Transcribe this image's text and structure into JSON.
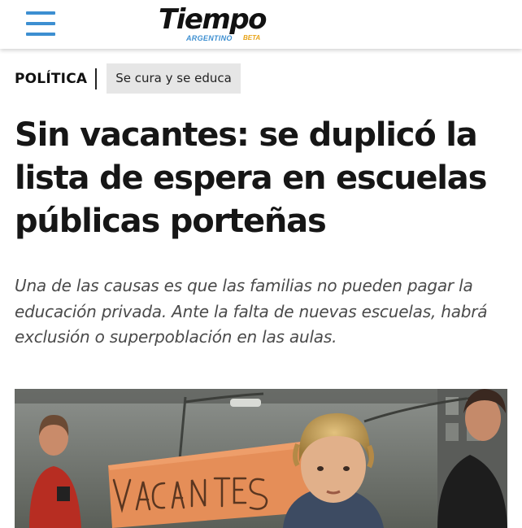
{
  "header": {
    "menu_icon": "hamburger-menu-icon",
    "logo": {
      "name": "Tiempo",
      "subtitle": "ARGENTINO",
      "badge": "BETA"
    },
    "colors": {
      "accent": "#3d8fd1",
      "beta": "#e8a317"
    }
  },
  "article": {
    "section": "POLÍTICA",
    "tag": "Se cura y se educa",
    "title": "Sin vacantes: se duplicó la lista de espera en escuelas públicas porteñas",
    "summary": "Una de las causas es que las familias no pueden pagar la educación privada. Ante la falta de nuevas escuelas, habrá exclusión o superpoblación en las aulas.",
    "image": {
      "sign_text": "VACANTES"
    }
  }
}
